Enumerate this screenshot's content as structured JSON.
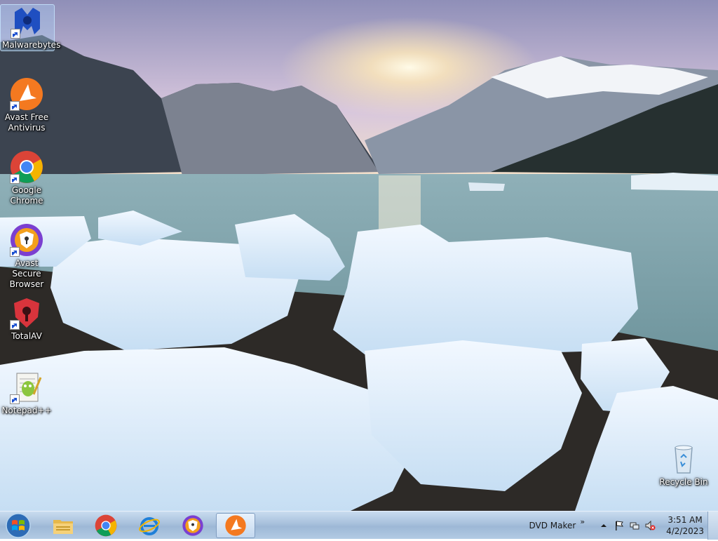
{
  "desktop": {
    "icons": [
      {
        "label": "Malwarebytes",
        "icon": "malwarebytes-icon",
        "selected": true
      },
      {
        "label": "Avast Free Antivirus",
        "icon": "avast-icon"
      },
      {
        "label": "Google Chrome",
        "icon": "chrome-icon"
      },
      {
        "label": "Avast Secure Browser",
        "icon": "avast-secure-browser-icon"
      },
      {
        "label": "TotalAV",
        "icon": "totalav-icon"
      },
      {
        "label": "Notepad++",
        "icon": "notepadpp-icon"
      },
      {
        "label": "Recycle Bin",
        "icon": "recycle-bin-icon"
      }
    ]
  },
  "taskbar": {
    "start": {
      "icon": "windows-start-icon"
    },
    "pinned": [
      {
        "icon": "file-explorer-icon"
      },
      {
        "icon": "chrome-icon"
      },
      {
        "icon": "internet-explorer-icon"
      },
      {
        "icon": "avast-secure-browser-icon"
      },
      {
        "icon": "avast-icon",
        "active": true
      }
    ],
    "toolbar_label": "DVD Maker",
    "toolbar_chevron": "»",
    "tray_icons": [
      "show-hidden-icons-arrow",
      "action-center-flag-icon",
      "network-icon",
      "volume-muted-icon"
    ],
    "clock": {
      "time": "3:51 AM",
      "date": "4/2/2023"
    }
  },
  "colors": {
    "taskbar": "#a7c0dc",
    "avast_orange": "#f47920",
    "chrome_red": "#db4437",
    "chrome_green": "#0f9d58",
    "chrome_yellow": "#f4b400",
    "chrome_blue": "#4285f4"
  }
}
